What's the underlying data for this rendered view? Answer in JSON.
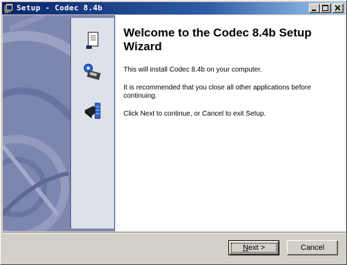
{
  "window": {
    "title": "Setup - Codec 8.4b"
  },
  "titlebar": {
    "buttons": [
      "minimize",
      "maximize",
      "close"
    ]
  },
  "side_panel": {
    "icons": [
      "document-icon",
      "key-disk-icon",
      "hard-drive-icon"
    ]
  },
  "main": {
    "heading": "Welcome to the Codec 8.4b Setup Wizard",
    "para1": "This will install Codec 8.4b on your computer.",
    "para2": "It is recommended that you close all other applications before continuing.",
    "para3": "Click Next to continue, or Cancel to exit Setup."
  },
  "footer": {
    "next_mnemonic": "N",
    "next_rest": "ext >",
    "cancel_label": "Cancel"
  },
  "colors": {
    "titlebar_start": "#0a246a",
    "titlebar_end": "#a6caf0",
    "side_panel": "#7d86ae",
    "face": "#d4d0c8"
  }
}
